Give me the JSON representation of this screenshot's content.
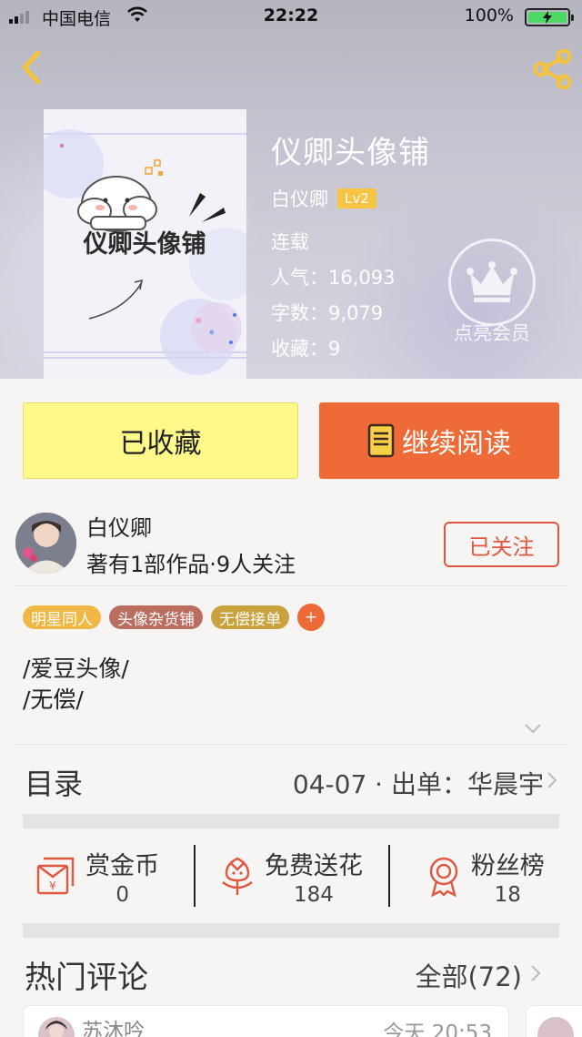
{
  "status_bar": {
    "carrier": "中国电信",
    "time": "22:22",
    "battery_percent": "100%",
    "battery_level": 1.0,
    "signal_bars": 2
  },
  "book": {
    "title": "仪卿头像铺",
    "cover_text": "仪卿头像铺",
    "author": "白仪卿",
    "level": "Lv2",
    "status": "连载",
    "popularity": "人气：16,093",
    "words": "字数：9,079",
    "favorites": "收藏：9"
  },
  "vip": {
    "label": "点亮会员"
  },
  "actions": {
    "collected_label": "已收藏",
    "continue_label": "继续阅读"
  },
  "author_card": {
    "name": "白仪卿",
    "stats": "著有1部作品·9人关注",
    "follow_label": "已关注"
  },
  "tags": [
    {
      "label": "明星同人",
      "color": "#f1b744"
    },
    {
      "label": "头像杂货铺",
      "color": "#bb6e5f"
    },
    {
      "label": "无偿接单",
      "color": "#c9a23d"
    }
  ],
  "tag_add_label": "+",
  "description": [
    "/爱豆头像/",
    "/无偿/"
  ],
  "catalog": {
    "title": "目录",
    "latest": "04-07 · 出单：华晨宇"
  },
  "rewards": [
    {
      "label": "赏金币",
      "value": "0",
      "icon": "red-envelope-yen-icon"
    },
    {
      "label": "免费送花",
      "value": "184",
      "icon": "flower-icon"
    },
    {
      "label": "粉丝榜",
      "value": "18",
      "icon": "medal-icon"
    }
  ],
  "comments": {
    "title": "热门评论",
    "all_label": "全部(72)",
    "first": {
      "name": "苏沐吟",
      "time": "今天 20:53"
    }
  },
  "colors": {
    "accent_orange": "#ee6a36",
    "collected_yellow": "#fff98a",
    "follow_red": "#e05740",
    "icon_yellow": "#f7c443",
    "icon_red": "#e05740"
  }
}
